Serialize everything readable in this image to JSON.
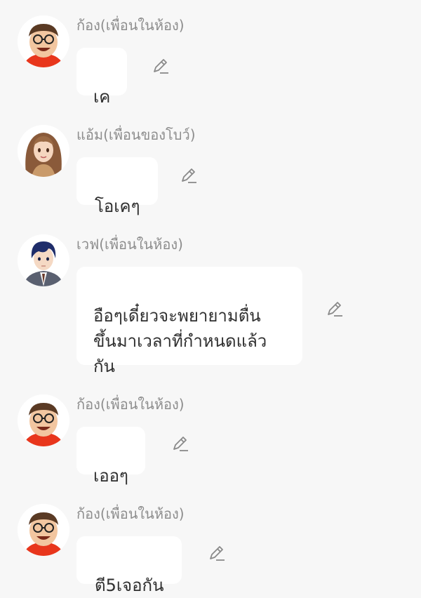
{
  "messages": [
    {
      "sender": "ก้อง(เพื่อนในห้อง)",
      "avatar": "chubby-man-glasses-red-shirt",
      "text": "เค",
      "edit_icon": "pencil-edit-icon"
    },
    {
      "sender": "แอ้ม(เพื่อนของโบว์)",
      "avatar": "woman-long-brown-hair",
      "text": "โอเคๆ",
      "edit_icon": "pencil-edit-icon"
    },
    {
      "sender": "เวฟ(เพื่อนในห้อง)",
      "avatar": "young-man-navy-hair-suit",
      "text": "อือๆเดี๋ยวจะพยายามตื่น\nขึ้นมาเวลาที่กำหนดแล้ว\nกัน",
      "edit_icon": "pencil-edit-icon"
    },
    {
      "sender": "ก้อง(เพื่อนในห้อง)",
      "avatar": "chubby-man-glasses-red-shirt",
      "text": "เออๆ",
      "edit_icon": "pencil-edit-icon"
    },
    {
      "sender": "ก้อง(เพื่อนในห้อง)",
      "avatar": "chubby-man-glasses-red-shirt",
      "text": "ตี5เจอกัน",
      "edit_icon": "pencil-edit-icon"
    }
  ],
  "colors": {
    "background": "#f7f7f7",
    "bubble": "#ffffff",
    "sender_text": "#8d8d8d",
    "message_text": "#2f2f2f",
    "edit_icon": "#8a8a8a"
  }
}
